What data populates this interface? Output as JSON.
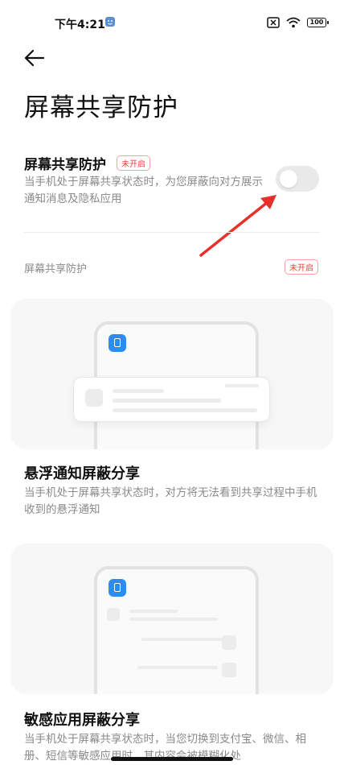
{
  "status_bar": {
    "time": "下午4:21",
    "battery": "100"
  },
  "page": {
    "title": "屏幕共享防护"
  },
  "setting": {
    "title": "屏幕共享防护",
    "badge": "未开启",
    "description": "当手机处于屏幕共享状态时，为您屏蔽向对方展示通知消息及隐私应用",
    "enabled": false
  },
  "section": {
    "header": "屏幕共享防护",
    "badge": "未开启"
  },
  "features": [
    {
      "title": "悬浮通知屏蔽分享",
      "description": "当手机处于屏幕共享状态时，对方将无法看到共享过程中手机收到的悬浮通知"
    },
    {
      "title": "敏感应用屏蔽分享",
      "description": "当手机处于屏幕共享状态时，当您切换到支付宝、微信、相册、短信等敏感应用时，其内容会被模糊化处"
    }
  ],
  "colors": {
    "accent_red": "#e8453c",
    "toggle_off": "#e9e9e9",
    "icon_blue": "#2e8bf0"
  }
}
